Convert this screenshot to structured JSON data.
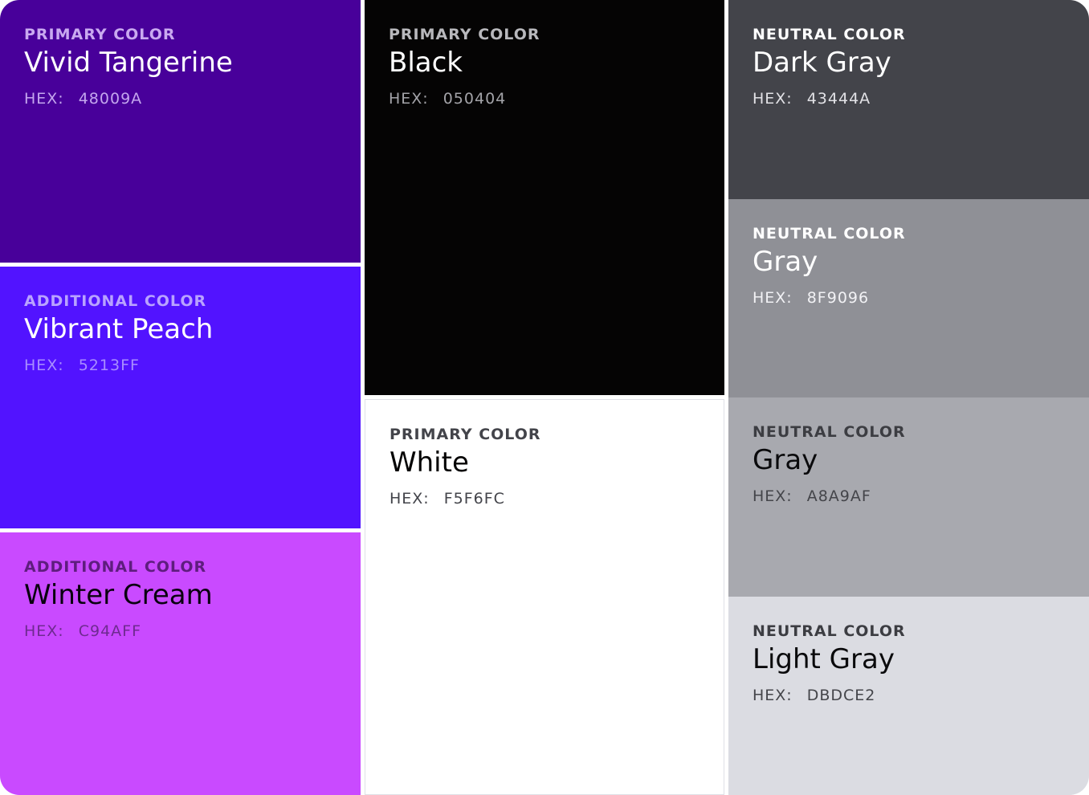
{
  "swatches": [
    {
      "id": "48009a",
      "category": "PRIMARY COLOR",
      "name": "Vivid Tangerine",
      "hex_label": "HEX:",
      "hex_value": "48009A",
      "bg": "#48009A",
      "category_color": "#C9A9F0",
      "name_color": "#FFFFFF",
      "hex_color": "#C4A6EE"
    },
    {
      "id": "5213ff",
      "category": "ADDITIONAL COLOR",
      "name": "Vibrant Peach",
      "hex_label": "HEX:",
      "hex_value": "5213FF",
      "bg": "#5213FF",
      "category_color": "#B9A3FF",
      "name_color": "#FFFFFF",
      "hex_color": "#A88EFF"
    },
    {
      "id": "c94aff",
      "category": "ADDITIONAL COLOR",
      "name": "Winter Cream",
      "hex_label": "HEX:",
      "hex_value": "C94AFF",
      "bg": "#C94AFF",
      "category_color": "#5E1D7E",
      "name_color": "#0A0210",
      "hex_color": "#6E2A90"
    },
    {
      "id": "050404",
      "category": "PRIMARY COLOR",
      "name": "Black",
      "hex_label": "HEX:",
      "hex_value": "050404",
      "bg": "#050404",
      "category_color": "#B8B8BC",
      "name_color": "#FFFFFF",
      "hex_color": "#A3A3A8"
    },
    {
      "id": "f5f6fc",
      "category": "PRIMARY COLOR",
      "name": "White",
      "hex_label": "HEX:",
      "hex_value": "F5F6FC",
      "bg": "#FFFFFF",
      "category_color": "#43444A",
      "name_color": "#050404",
      "hex_color": "#43444A"
    },
    {
      "id": "43444a",
      "category": "NEUTRAL COLOR",
      "name": "Dark Gray",
      "hex_label": "HEX:",
      "hex_value": "43444A",
      "bg": "#43444A",
      "category_color": "#FFFFFF",
      "name_color": "#FFFFFF",
      "hex_color": "#E2E2E6"
    },
    {
      "id": "8f9096",
      "category": "NEUTRAL COLOR",
      "name": "Gray",
      "hex_label": "HEX:",
      "hex_value": "8F9096",
      "bg": "#8F9096",
      "category_color": "#FFFFFF",
      "name_color": "#FFFFFF",
      "hex_color": "#F2F2F5"
    },
    {
      "id": "a8a9af",
      "category": "NEUTRAL COLOR",
      "name": "Gray",
      "hex_label": "HEX:",
      "hex_value": "A8A9AF",
      "bg": "#A8A9AF",
      "category_color": "#3C3D42",
      "name_color": "#0A0A0C",
      "hex_color": "#44454A"
    },
    {
      "id": "dbdce2",
      "category": "NEUTRAL COLOR",
      "name": "Light Gray",
      "hex_label": "HEX:",
      "hex_value": "DBDCE2",
      "bg": "#DBDCE2",
      "category_color": "#3C3D42",
      "name_color": "#0A0A0C",
      "hex_color": "#44454A"
    }
  ]
}
